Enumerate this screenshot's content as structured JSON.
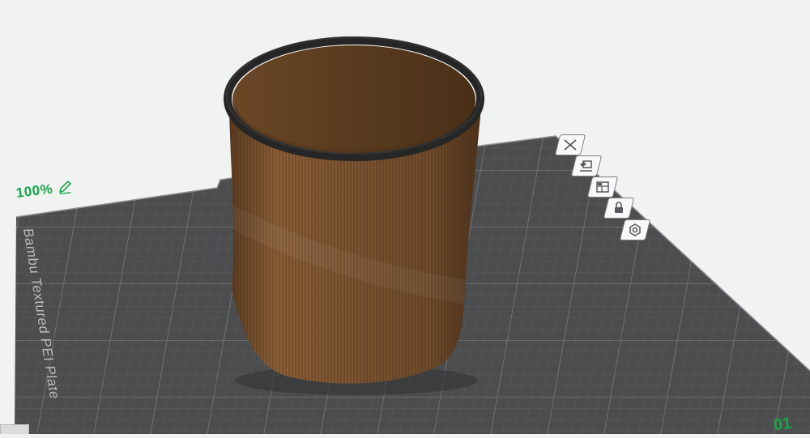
{
  "plate": {
    "label": "Bambu Textured PEI Plate",
    "number": "01",
    "scale_percent": "100%"
  },
  "plate_toolbar": [
    {
      "name": "delete-plate",
      "icon": "close-icon"
    },
    {
      "name": "arrange-plate",
      "icon": "arrange-icon"
    },
    {
      "name": "orient-plate",
      "icon": "layout-icon"
    },
    {
      "name": "lock-plate",
      "icon": "lock-icon"
    },
    {
      "name": "plate-settings",
      "icon": "settings-icon"
    }
  ],
  "object": {
    "kind": "cylindrical cup model",
    "body_color": "#7b5331",
    "rim_color": "#262626"
  },
  "colors": {
    "background": "#f1f2f2",
    "plate": "#4b4d4e",
    "grid": "#6e7173",
    "accent": "#19a54a"
  }
}
